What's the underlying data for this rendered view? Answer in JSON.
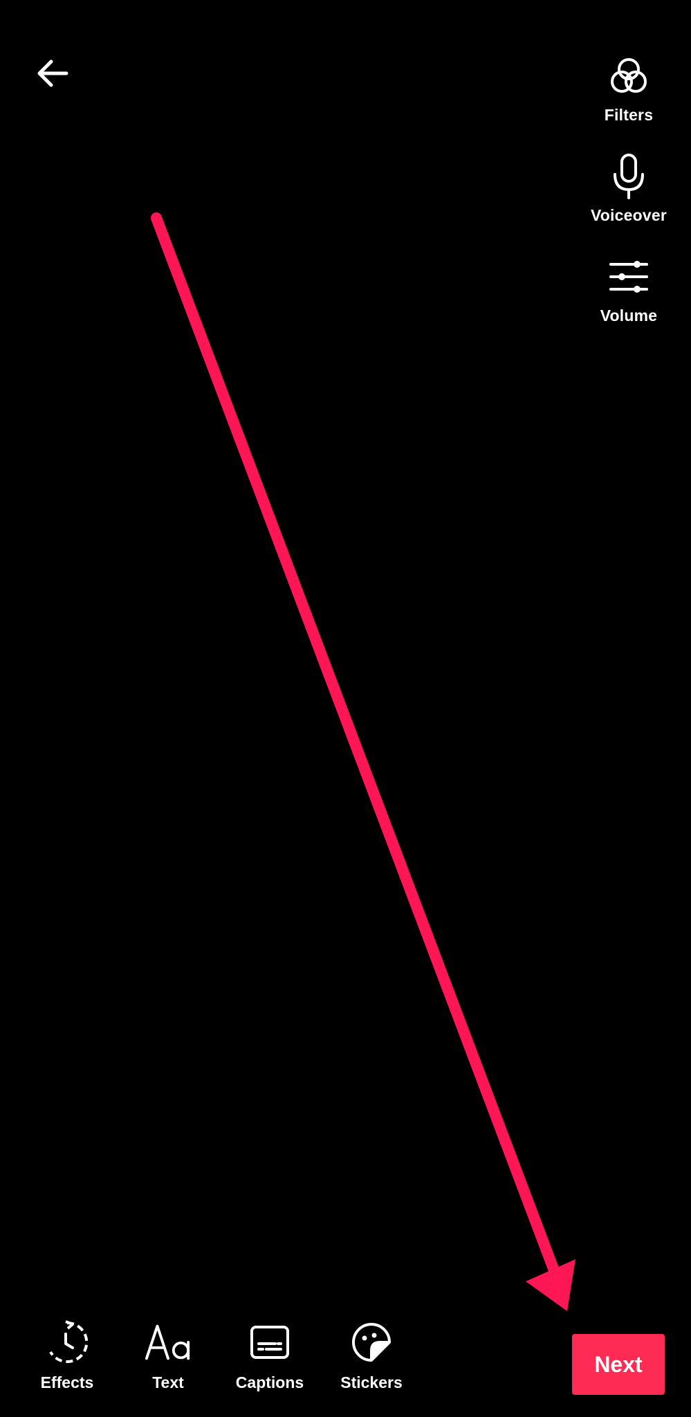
{
  "top_bar": {
    "back_icon": "arrow-left-icon"
  },
  "right_tools": [
    {
      "label": "Filters",
      "icon": "filters-icon"
    },
    {
      "label": "Voiceover",
      "icon": "microphone-icon"
    },
    {
      "label": "Volume",
      "icon": "sliders-icon"
    }
  ],
  "bottom_tools": [
    {
      "label": "Effects",
      "icon": "effects-icon"
    },
    {
      "label": "Text",
      "icon": "text-icon"
    },
    {
      "label": "Captions",
      "icon": "captions-icon"
    },
    {
      "label": "Stickers",
      "icon": "stickers-icon"
    }
  ],
  "next_button": {
    "label": "Next"
  },
  "colors": {
    "background": "#000000",
    "accent": "#fe2c55",
    "annotation_arrow": "#ff1654",
    "foreground": "#ffffff"
  }
}
